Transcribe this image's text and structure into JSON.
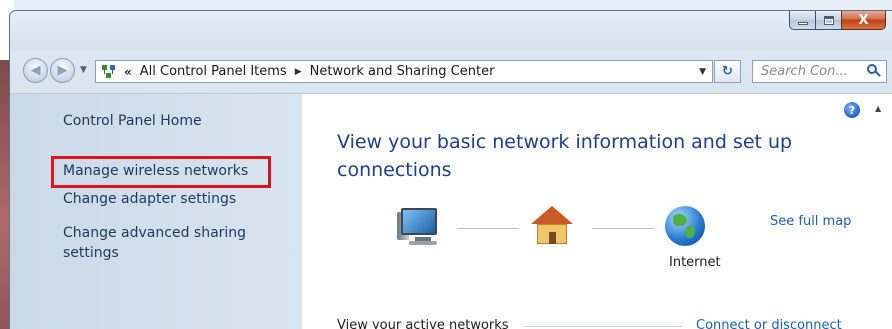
{
  "window": {
    "caption": {
      "minimize_icon": "minimize-icon",
      "maximize_icon": "maximize-icon",
      "close_icon": "close-icon",
      "close_glyph": "X"
    }
  },
  "navbar": {
    "back_icon": "back-arrow-icon",
    "forward_icon": "forward-arrow-icon",
    "address": {
      "overflow_chevron": "«",
      "crumbs": [
        "All Control Panel Items",
        "Network and Sharing Center"
      ]
    },
    "search": {
      "placeholder": "Search Con..."
    }
  },
  "sidebar": {
    "items": [
      {
        "label": "Control Panel Home"
      },
      {
        "label": "Manage wireless networks",
        "highlighted": true
      },
      {
        "label": "Change adapter settings"
      },
      {
        "label": "Change advanced sharing settings"
      }
    ],
    "highlight_color": "#e0121c"
  },
  "main": {
    "title": "View your basic network information and set up connections",
    "map": {
      "nodes": [
        {
          "icon": "computer-icon",
          "label": ""
        },
        {
          "icon": "home-network-icon",
          "label": ""
        },
        {
          "icon": "internet-globe-icon",
          "label": "Internet"
        }
      ],
      "see_full_map": "See full map"
    },
    "active_networks_label": "View your active networks",
    "connect_link": "Connect or disconnect",
    "help_glyph": "?"
  },
  "colors": {
    "link": "#1d5fb5",
    "title": "#1e3f8e",
    "sidebar_text": "#1e395b"
  }
}
